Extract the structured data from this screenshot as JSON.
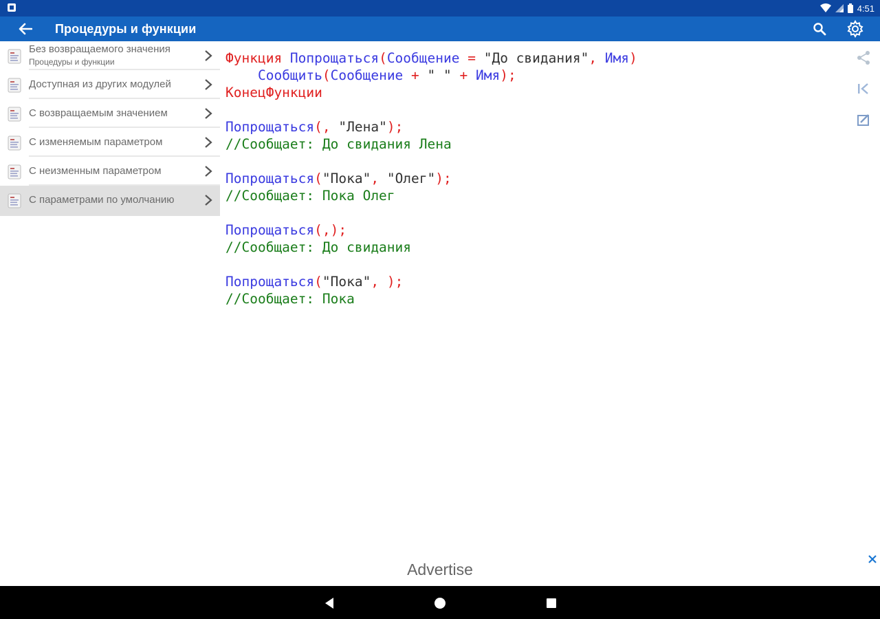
{
  "status_bar": {
    "time": "4:51"
  },
  "app_bar": {
    "title": "Процедуры и функции"
  },
  "sidebar": {
    "items": [
      {
        "label": "Без возвращаемого значения",
        "sublabel": "Процедуры и функции"
      },
      {
        "label": "Доступная из других модулей"
      },
      {
        "label": "С возвращаемым значением"
      },
      {
        "label": "С изменяемым параметром"
      },
      {
        "label": "С неизменным параметром"
      },
      {
        "label": "С параметрами по умолчанию"
      }
    ],
    "selected_index": 5
  },
  "code": {
    "lines": [
      [
        {
          "t": "Функция ",
          "c": "kw"
        },
        {
          "t": "Попрощаться",
          "c": "fn"
        },
        {
          "t": "(",
          "c": "op"
        },
        {
          "t": "Сообщение",
          "c": "fn"
        },
        {
          "t": " = ",
          "c": "op"
        },
        {
          "t": "\"До свидания\"",
          "c": "str"
        },
        {
          "t": ", ",
          "c": "op"
        },
        {
          "t": "Имя",
          "c": "fn"
        },
        {
          "t": ")",
          "c": "op"
        }
      ],
      [
        {
          "t": "    ",
          "c": "str"
        },
        {
          "t": "Сообщить",
          "c": "fn"
        },
        {
          "t": "(",
          "c": "op"
        },
        {
          "t": "Сообщение",
          "c": "fn"
        },
        {
          "t": " + ",
          "c": "op"
        },
        {
          "t": "\" \"",
          "c": "str"
        },
        {
          "t": " + ",
          "c": "op"
        },
        {
          "t": "Имя",
          "c": "fn"
        },
        {
          "t": ");",
          "c": "op"
        }
      ],
      [
        {
          "t": "КонецФункции",
          "c": "kw"
        }
      ],
      [],
      [
        {
          "t": "Попрощаться",
          "c": "fn"
        },
        {
          "t": "(, ",
          "c": "op"
        },
        {
          "t": "\"Лена\"",
          "c": "str"
        },
        {
          "t": ");",
          "c": "op"
        }
      ],
      [
        {
          "t": "//Сообщает: До свидания Лена",
          "c": "cm"
        }
      ],
      [],
      [
        {
          "t": "Попрощаться",
          "c": "fn"
        },
        {
          "t": "(",
          "c": "op"
        },
        {
          "t": "\"Пока\"",
          "c": "str"
        },
        {
          "t": ", ",
          "c": "op"
        },
        {
          "t": "\"Олег\"",
          "c": "str"
        },
        {
          "t": ");",
          "c": "op"
        }
      ],
      [
        {
          "t": "//Сообщает: Пока Олег",
          "c": "cm"
        }
      ],
      [],
      [
        {
          "t": "Попрощаться",
          "c": "fn"
        },
        {
          "t": "(,);",
          "c": "op"
        }
      ],
      [
        {
          "t": "//Сообщает: До свидания",
          "c": "cm"
        }
      ],
      [],
      [
        {
          "t": "Попрощаться",
          "c": "fn"
        },
        {
          "t": "(",
          "c": "op"
        },
        {
          "t": "\"Пока\"",
          "c": "str"
        },
        {
          "t": ", );",
          "c": "op"
        }
      ],
      [
        {
          "t": "//Сообщает: Пока",
          "c": "cm"
        }
      ]
    ]
  },
  "side_tools": {
    "icons": [
      "share-icon",
      "first-page-icon",
      "edit-icon"
    ]
  },
  "ad": {
    "label": "Advertise"
  },
  "colors": {
    "status_bar": "#0d47a1",
    "app_bar": "#1565c0",
    "keyword": "#e02020",
    "identifier": "#3a3ae0",
    "comment": "#1a7d1a",
    "selected_item": "#e0e0e0"
  }
}
